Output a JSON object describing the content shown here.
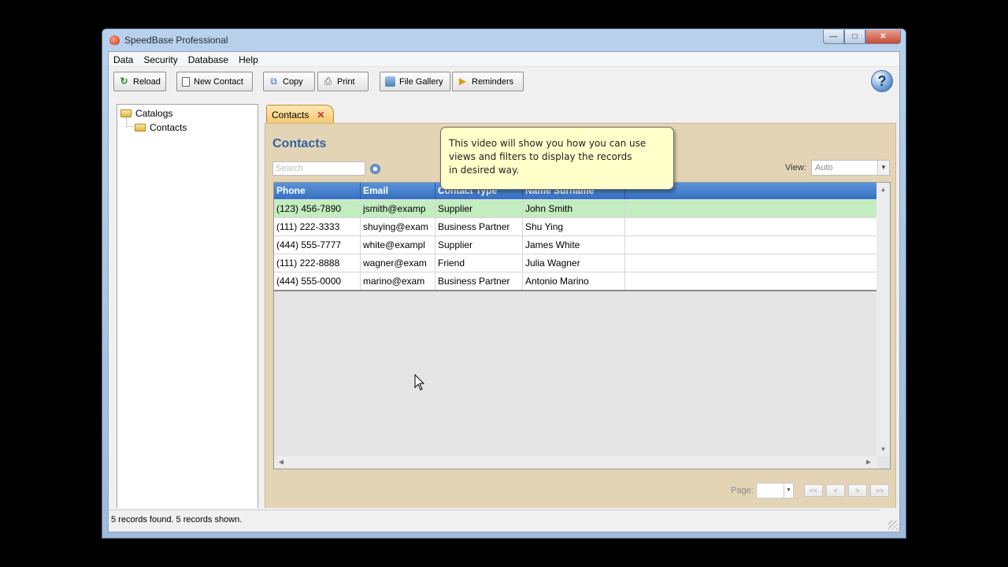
{
  "window": {
    "title": "SpeedBase Professional"
  },
  "menu": [
    "Data",
    "Security",
    "Database",
    "Help"
  ],
  "toolbar": {
    "reload": "Reload",
    "new_contact": "New Contact",
    "copy": "Copy",
    "print": "Print",
    "file_gallery": "File Gallery",
    "reminders": "Reminders"
  },
  "tree": {
    "root": "Catalogs",
    "child": "Contacts"
  },
  "tab": {
    "label": "Contacts"
  },
  "panel": {
    "title": "Contacts",
    "search_placeholder": "Search",
    "view_label": "View:",
    "view_value": "Auto"
  },
  "grid": {
    "columns": [
      "Phone",
      "Email",
      "Contact Type",
      "Name Surname"
    ],
    "rows": [
      [
        "(123) 456-7890",
        "jsmith@examp",
        "Supplier",
        "John Smith"
      ],
      [
        "(111) 222-3333",
        "shuying@exam",
        "Business Partner",
        "Shu Ying"
      ],
      [
        "(444) 555-7777",
        "white@exampl",
        "Supplier",
        "James White"
      ],
      [
        "(111) 222-8888",
        "wagner@exam",
        "Friend",
        "Julia Wagner"
      ],
      [
        "(444) 555-0000",
        "marino@exam",
        "Business Partner",
        "Antonio Marino"
      ]
    ]
  },
  "pager": {
    "label": "Page:",
    "first": "<<",
    "prev": "<",
    "next": ">",
    "last": ">>"
  },
  "tooltip": {
    "line1": "This video will show you how you can use",
    "line2": "views and filters to display the records",
    "line3": "in desired way."
  },
  "status": {
    "text": "5 records found. 5 records shown."
  },
  "colors": {
    "header": "#3770c0",
    "selected_row": "#c3ecc0",
    "panel_bg": "#e3d4b6",
    "tab_bg": "#f5c56a",
    "tooltip_bg": "#ffffc9"
  }
}
